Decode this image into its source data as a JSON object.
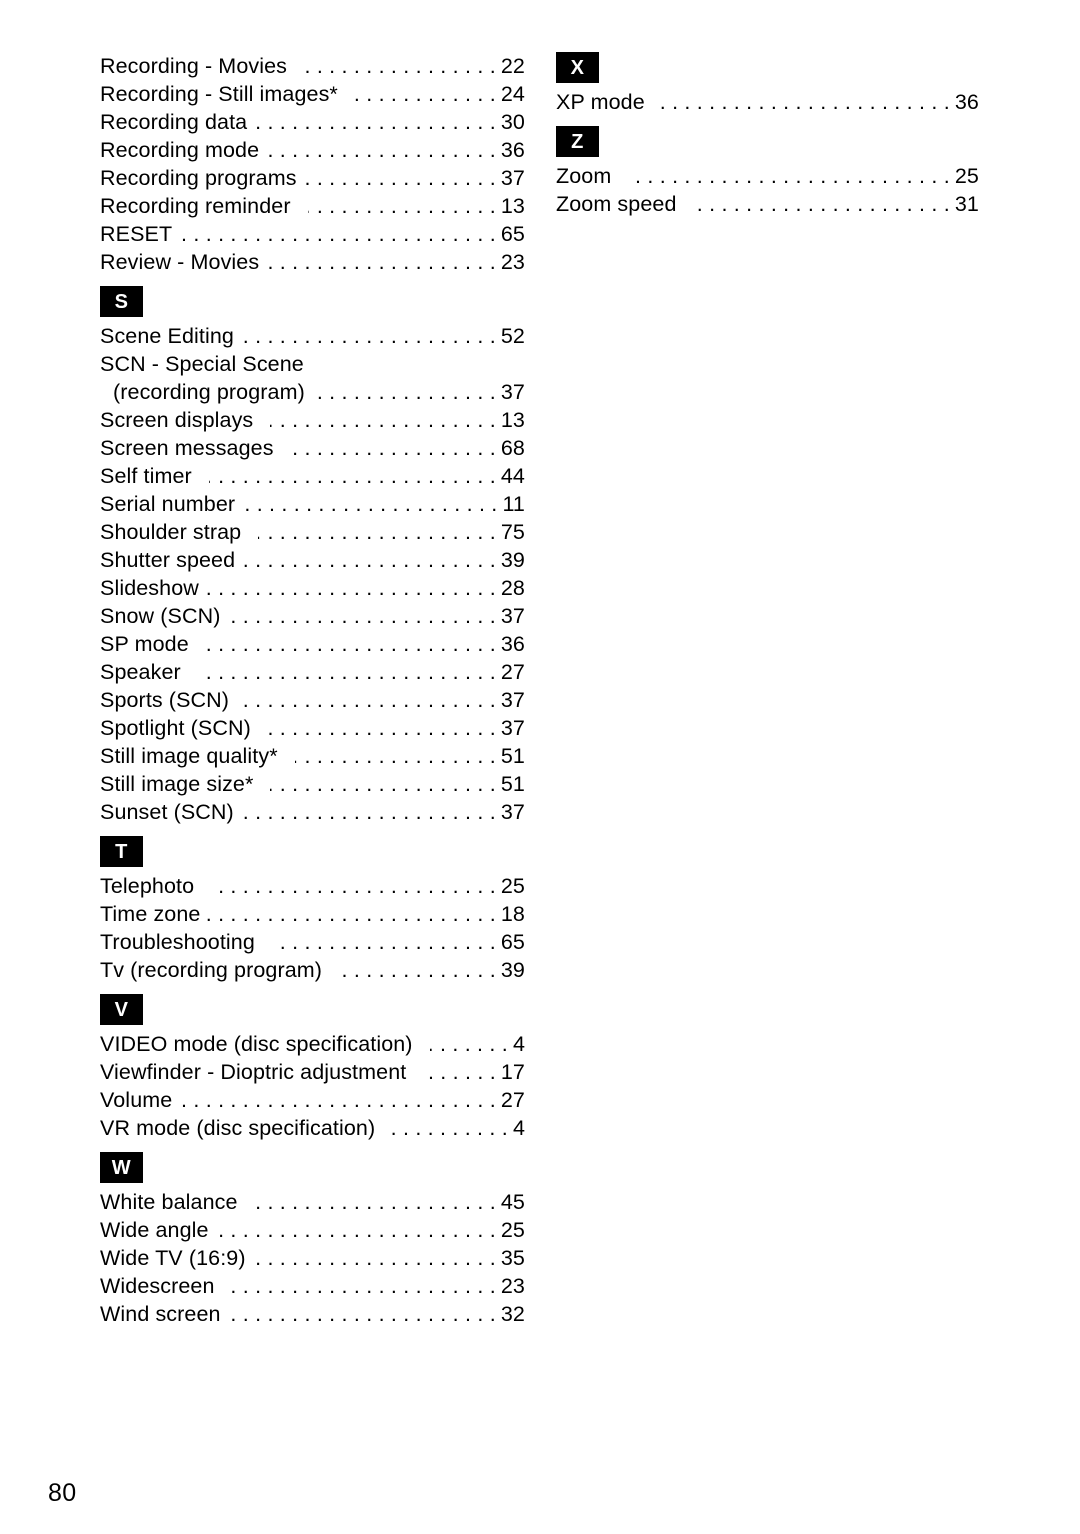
{
  "page": {
    "folio": "80",
    "document_type": "index"
  },
  "columns": [
    {
      "id": "left",
      "blocks": [
        {
          "type": "entries",
          "entries": [
            {
              "label": "Recording - Movies",
              "page": "22",
              "extra_gap": true
            },
            {
              "label": "Recording - Still images*",
              "page": "24",
              "extra_gap": true
            },
            {
              "label": "Recording data",
              "page": "30",
              "extra_gap": false
            },
            {
              "label": "Recording mode",
              "page": "36",
              "extra_gap": false
            },
            {
              "label": "Recording programs",
              "page": "37",
              "extra_gap": false
            },
            {
              "label": "Recording reminder",
              "page": "13",
              "extra_gap": true
            },
            {
              "label": "RESET",
              "page": "65",
              "extra_gap": false
            },
            {
              "label": "Review - Movies",
              "page": "23",
              "extra_gap": false
            }
          ]
        },
        {
          "type": "section",
          "letter": "S",
          "entries": [
            {
              "label": "Scene Editing",
              "page": "52",
              "extra_gap": false
            },
            {
              "head": "SCN - Special Scene",
              "label": "(recording program)",
              "page": "37",
              "indented": true,
              "extra_gap": false
            },
            {
              "label": "Screen displays",
              "page": "13",
              "extra_gap": true
            },
            {
              "label": "Screen messages",
              "page": "68",
              "extra_gap": true
            },
            {
              "label": "Self timer",
              "page": "44",
              "extra_gap": true
            },
            {
              "label": "Serial number",
              "page": "11",
              "extra_gap": false
            },
            {
              "label": "Shoulder strap",
              "page": "75",
              "extra_gap": true
            },
            {
              "label": "Shutter speed",
              "page": "39",
              "extra_gap": false
            },
            {
              "label": "Slideshow",
              "page": "28",
              "extra_gap": false
            },
            {
              "label": "Snow (SCN)",
              "page": "37",
              "extra_gap": false
            },
            {
              "label": "SP mode",
              "page": "36",
              "extra_gap": true
            },
            {
              "label": "Speaker",
              "page": "27",
              "extra_gap": true
            },
            {
              "label": "Sports (SCN)",
              "page": "37",
              "extra_gap": false
            },
            {
              "label": "Spotlight (SCN)",
              "page": "37",
              "extra_gap": true
            },
            {
              "label": "Still image quality*",
              "page": "51",
              "extra_gap": true
            },
            {
              "label": "Still image size*",
              "page": "51",
              "extra_gap": true
            },
            {
              "label": "Sunset (SCN)",
              "page": "37",
              "extra_gap": false
            }
          ]
        },
        {
          "type": "section",
          "letter": "T",
          "entries": [
            {
              "label": "Telephoto",
              "page": "25",
              "extra_gap": true
            },
            {
              "label": "Time zone",
              "page": "18",
              "extra_gap": false
            },
            {
              "label": "Troubleshooting",
              "page": "65",
              "extra_gap": true
            },
            {
              "label": "Tv (recording program)",
              "page": "39",
              "extra_gap": true
            }
          ]
        },
        {
          "type": "section",
          "letter": "V",
          "entries": [
            {
              "label": "VIDEO mode (disc specification)",
              "page": "4",
              "extra_gap": true
            },
            {
              "label": "Viewfinder - Dioptric adjustment",
              "page": "17",
              "extra_gap": true
            },
            {
              "label": "Volume",
              "page": "27",
              "extra_gap": false
            },
            {
              "label": "VR mode (disc specification)",
              "page": "4",
              "extra_gap": true
            }
          ]
        },
        {
          "type": "section",
          "letter": "W",
          "entries": [
            {
              "label": "White balance",
              "page": "45",
              "extra_gap": true
            },
            {
              "label": "Wide angle",
              "page": "25",
              "extra_gap": false
            },
            {
              "label": "Wide TV (16:9)",
              "page": "35",
              "extra_gap": false
            },
            {
              "label": "Widescreen",
              "page": "23",
              "extra_gap": true
            },
            {
              "label": "Wind screen",
              "page": "32",
              "extra_gap": false
            }
          ]
        }
      ]
    },
    {
      "id": "right",
      "blocks": [
        {
          "type": "section",
          "letter": "X",
          "first": true,
          "entries": [
            {
              "label": "XP mode",
              "page": "36",
              "extra_gap": false
            }
          ]
        },
        {
          "type": "section",
          "letter": "Z",
          "entries": [
            {
              "label": "Zoom",
              "page": "25",
              "extra_gap": true
            },
            {
              "label": "Zoom speed",
              "page": "31",
              "extra_gap": true
            }
          ]
        }
      ]
    }
  ]
}
